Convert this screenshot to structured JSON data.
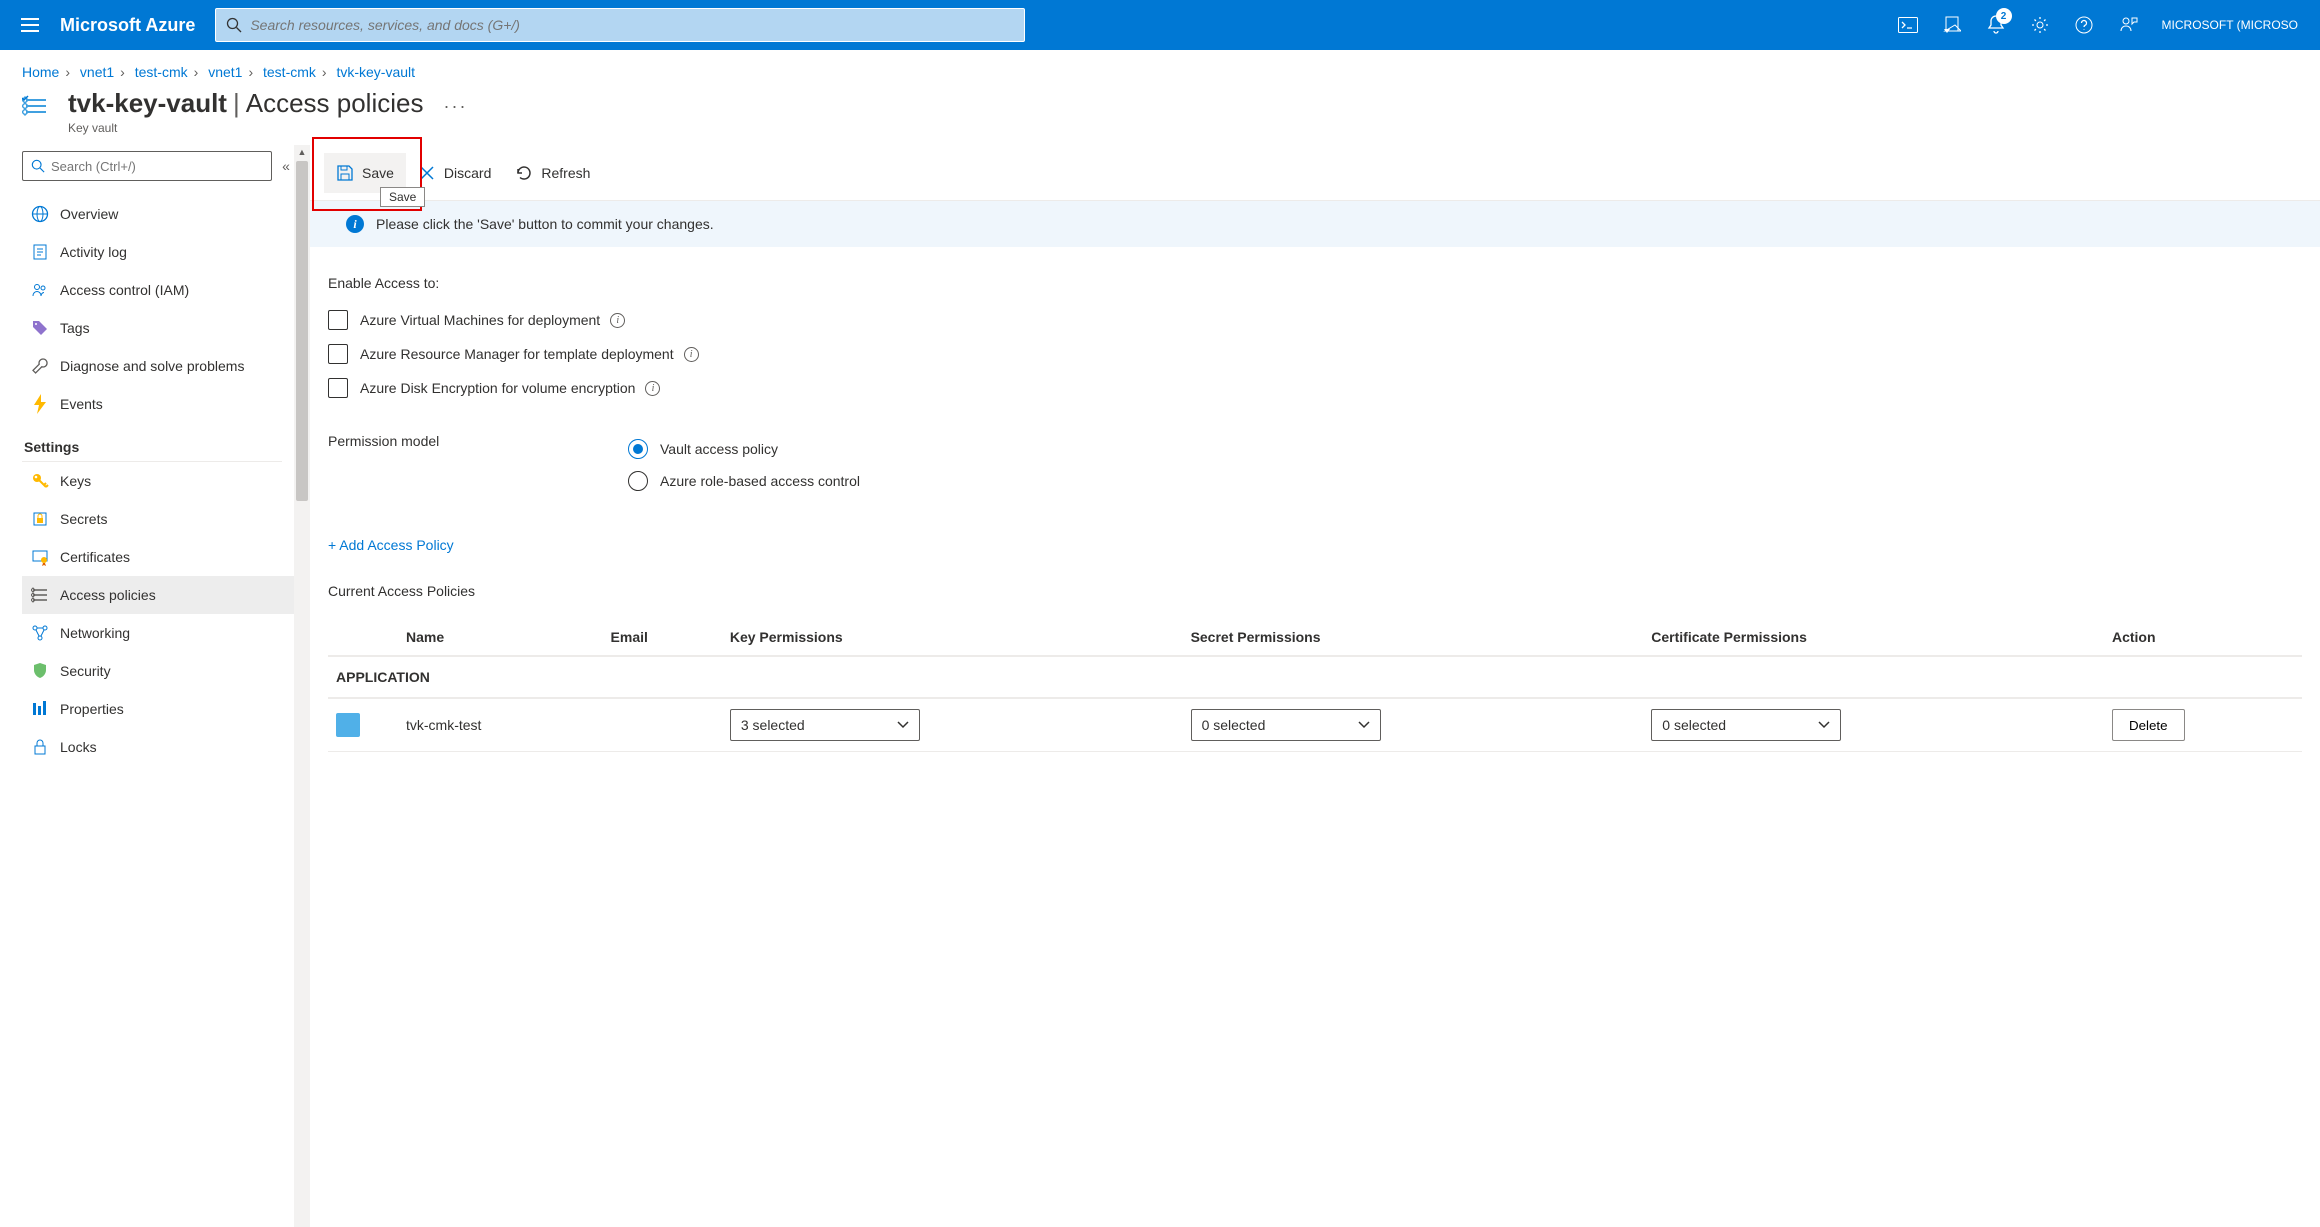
{
  "topbar": {
    "brand": "Microsoft Azure",
    "search_placeholder": "Search resources, services, and docs (G+/)",
    "notification_count": "2",
    "tenant": "MICROSOFT (MICROSO"
  },
  "breadcrumb": {
    "items": [
      "Home",
      "vnet1",
      "test-cmk",
      "vnet1",
      "test-cmk",
      "tvk-key-vault"
    ]
  },
  "page": {
    "resource_name": "tvk-key-vault",
    "section": "Access policies",
    "resource_type": "Key vault"
  },
  "sidebar": {
    "search_placeholder": "Search (Ctrl+/)",
    "items_top": [
      {
        "label": "Overview",
        "icon": "globe"
      },
      {
        "label": "Activity log",
        "icon": "log"
      },
      {
        "label": "Access control (IAM)",
        "icon": "people"
      },
      {
        "label": "Tags",
        "icon": "tag"
      },
      {
        "label": "Diagnose and solve problems",
        "icon": "wrench"
      },
      {
        "label": "Events",
        "icon": "bolt"
      }
    ],
    "group_settings": "Settings",
    "items_settings": [
      {
        "label": "Keys",
        "icon": "key"
      },
      {
        "label": "Secrets",
        "icon": "secret"
      },
      {
        "label": "Certificates",
        "icon": "cert"
      },
      {
        "label": "Access policies",
        "icon": "policies",
        "active": true
      },
      {
        "label": "Networking",
        "icon": "net"
      },
      {
        "label": "Security",
        "icon": "shield"
      },
      {
        "label": "Properties",
        "icon": "props"
      },
      {
        "label": "Locks",
        "icon": "lock"
      }
    ]
  },
  "toolbar": {
    "save": "Save",
    "discard": "Discard",
    "refresh": "Refresh",
    "tooltip": "Save"
  },
  "banner": {
    "text": "Please click the 'Save' button to commit your changes."
  },
  "form": {
    "enable_access_label": "Enable Access to:",
    "cb1": "Azure Virtual Machines for deployment",
    "cb2": "Azure Resource Manager for template deployment",
    "cb3": "Azure Disk Encryption for volume encryption",
    "perm_label": "Permission model",
    "radio1": "Vault access policy",
    "radio2": "Azure role-based access control",
    "add_link": "+ Add Access Policy",
    "current_label": "Current Access Policies"
  },
  "table": {
    "headers": {
      "name": "Name",
      "email": "Email",
      "key": "Key Permissions",
      "secret": "Secret Permissions",
      "cert": "Certificate Permissions",
      "action": "Action"
    },
    "group": "APPLICATION",
    "rows": [
      {
        "name": "tvk-cmk-test",
        "key": "3 selected",
        "secret": "0 selected",
        "cert": "0 selected",
        "delete": "Delete"
      }
    ]
  }
}
